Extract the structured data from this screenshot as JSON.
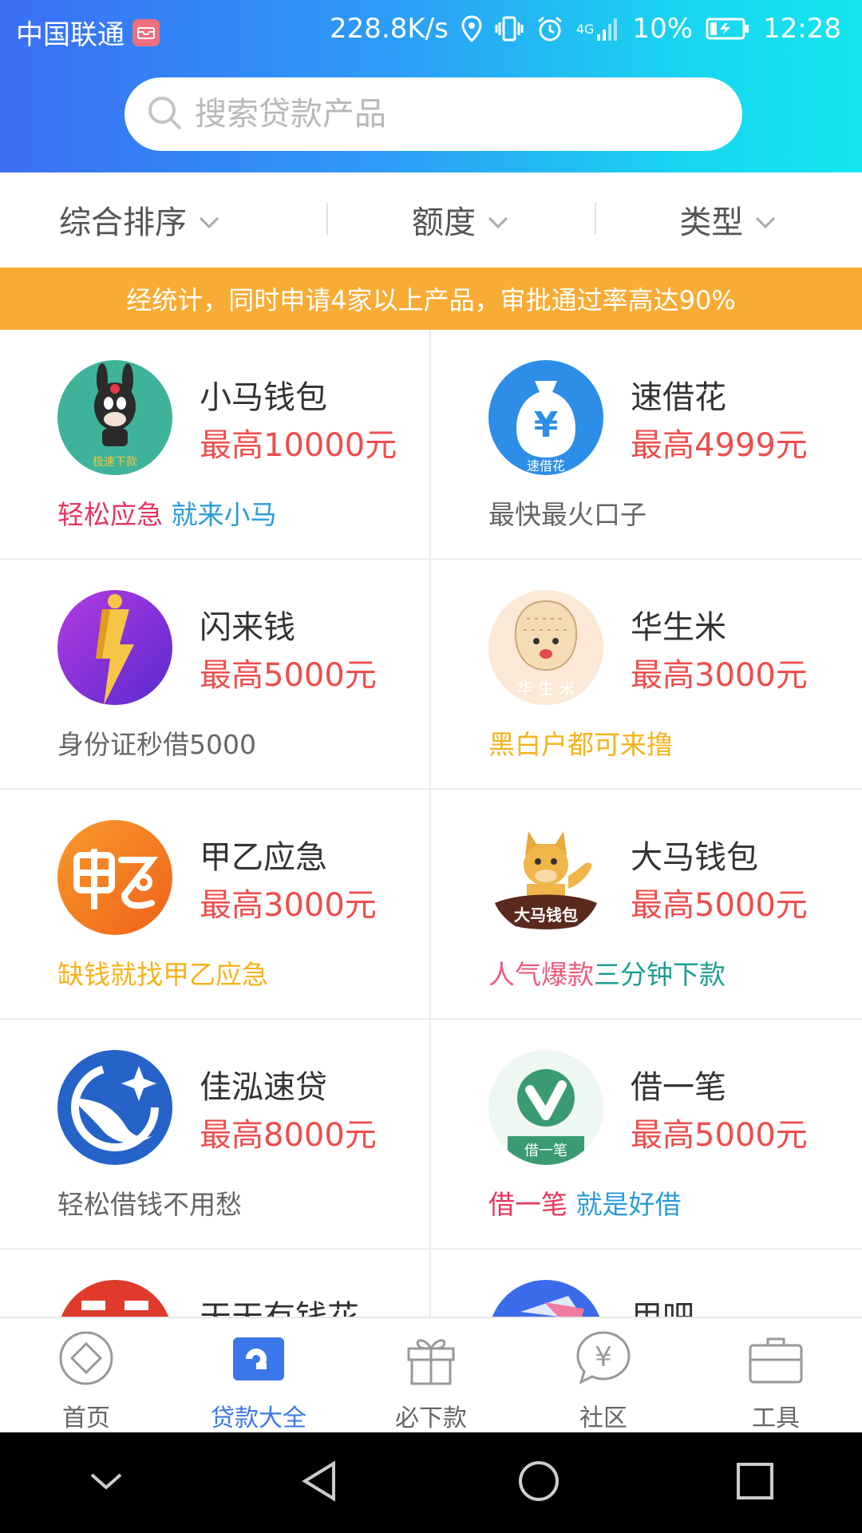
{
  "status_bar": {
    "carrier": "中国联通",
    "speed": "228.8K/s",
    "network": "4G",
    "battery": "10%",
    "time": "12:28"
  },
  "search": {
    "placeholder": "搜索贷款产品"
  },
  "filters": [
    {
      "label": "综合排序"
    },
    {
      "label": "额度"
    },
    {
      "label": "类型"
    }
  ],
  "notice": "经统计，同时申请4家以上产品，审批通过率高达90%",
  "products": [
    {
      "name": "小马钱包",
      "amount": "最高10000元",
      "tag1": "轻松应急",
      "tag2": "就来小马",
      "logo_text": "极速下款",
      "logo_color": "#3fb39a"
    },
    {
      "name": "速借花",
      "amount": "最高4999元",
      "tag1": "最快最火口子",
      "logo_text": "速借花",
      "logo_color": "#2d8ee8"
    },
    {
      "name": "闪来钱",
      "amount": "最高5000元",
      "tag1": "身份证秒借5000",
      "logo_color": "#8a33d8"
    },
    {
      "name": "华生米",
      "amount": "最高3000元",
      "tag1": "黑白户都可来撸",
      "logo_text": "华 生 米",
      "logo_color": "#fbe8d6"
    },
    {
      "name": "甲乙应急",
      "amount": "最高3000元",
      "tag1": "缺钱就找甲乙应急",
      "logo_color": "#f47c22"
    },
    {
      "name": "大马钱包",
      "amount": "最高5000元",
      "tag1": "人气爆款",
      "tag2": "三分钟下款",
      "logo_text": "大马钱包",
      "logo_color": "#ffffff"
    },
    {
      "name": "佳泓速贷",
      "amount": "最高8000元",
      "tag1": "轻松借钱不用愁",
      "logo_color": "#2563c9"
    },
    {
      "name": "借一笔",
      "amount": "最高5000元",
      "tag1": "借一笔",
      "tag2": "就是好借",
      "logo_text": "借一笔",
      "logo_color": "#eef7f1"
    },
    {
      "name": "天天有钱花",
      "logo_color": "#e03a2a"
    },
    {
      "name": "用吧",
      "logo_color": "#3b6be8"
    }
  ],
  "bottom_nav": [
    {
      "label": "首页"
    },
    {
      "label": "贷款大全"
    },
    {
      "label": "必下款"
    },
    {
      "label": "社区"
    },
    {
      "label": "工具"
    }
  ],
  "colors": {
    "accent": "#3a78ea",
    "amount": "#ee4d4d",
    "notice_bg": "#f9ac35"
  }
}
